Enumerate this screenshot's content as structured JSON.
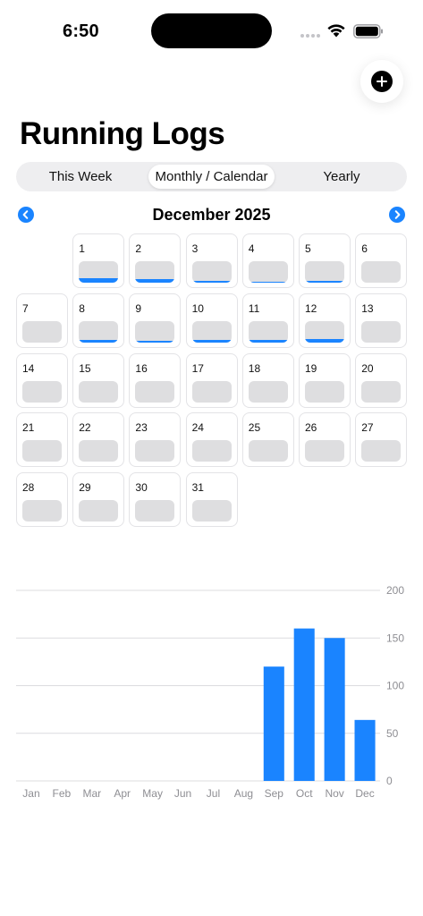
{
  "status_bar": {
    "time": "6:50"
  },
  "page": {
    "title": "Running Logs"
  },
  "tabs": [
    {
      "label": "This Week",
      "active": false
    },
    {
      "label": "Monthly / Calendar",
      "active": true
    },
    {
      "label": "Yearly",
      "active": false
    }
  ],
  "calendar": {
    "month_label": "December 2025",
    "first_weekday_offset": 1,
    "days": [
      {
        "day": "1",
        "level": 0.3
      },
      {
        "day": "2",
        "level": 0.25
      },
      {
        "day": "3",
        "level": 0.15
      },
      {
        "day": "4",
        "level": 0.08
      },
      {
        "day": "5",
        "level": 0.15
      },
      {
        "day": "6",
        "level": 0
      },
      {
        "day": "7",
        "level": 0
      },
      {
        "day": "8",
        "level": 0.2
      },
      {
        "day": "9",
        "level": 0.1
      },
      {
        "day": "10",
        "level": 0.2
      },
      {
        "day": "11",
        "level": 0.2
      },
      {
        "day": "12",
        "level": 0.25
      },
      {
        "day": "13",
        "level": 0
      },
      {
        "day": "14",
        "level": 0
      },
      {
        "day": "15",
        "level": 0
      },
      {
        "day": "16",
        "level": 0
      },
      {
        "day": "17",
        "level": 0
      },
      {
        "day": "18",
        "level": 0
      },
      {
        "day": "19",
        "level": 0
      },
      {
        "day": "20",
        "level": 0
      },
      {
        "day": "21",
        "level": 0
      },
      {
        "day": "22",
        "level": 0
      },
      {
        "day": "23",
        "level": 0
      },
      {
        "day": "24",
        "level": 0
      },
      {
        "day": "25",
        "level": 0
      },
      {
        "day": "26",
        "level": 0
      },
      {
        "day": "27",
        "level": 0
      },
      {
        "day": "28",
        "level": 0
      },
      {
        "day": "29",
        "level": 0
      },
      {
        "day": "30",
        "level": 0
      },
      {
        "day": "31",
        "level": 0
      }
    ]
  },
  "colors": {
    "accent": "#1a84ff",
    "bar_empty": "#dedee0",
    "grid": "#dcdcdf",
    "axis_label": "#8e8e93"
  },
  "chart_data": {
    "type": "bar",
    "categories": [
      "Jan",
      "Feb",
      "Mar",
      "Apr",
      "May",
      "Jun",
      "Jul",
      "Aug",
      "Sep",
      "Oct",
      "Nov",
      "Dec"
    ],
    "values": [
      0,
      0,
      0,
      0,
      0,
      0,
      0,
      0,
      120,
      160,
      150,
      64
    ],
    "yticks": [
      "0",
      "50",
      "100",
      "150",
      "200"
    ],
    "ylim": [
      0,
      200
    ],
    "y_axis_position": "right",
    "grid": true
  }
}
